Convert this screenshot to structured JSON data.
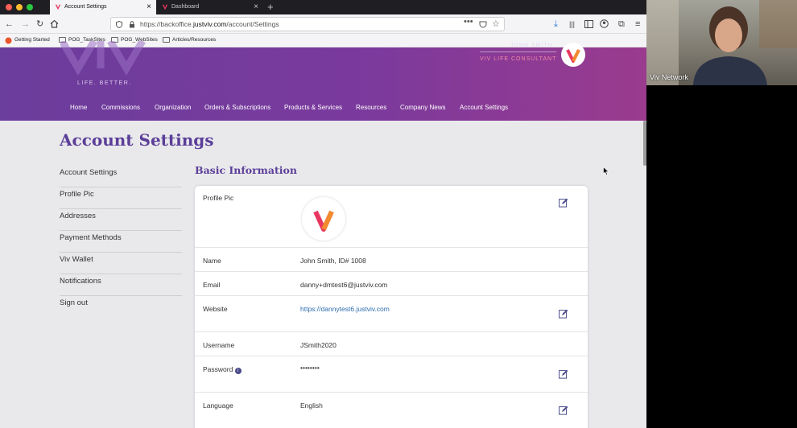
{
  "browser": {
    "tabs": [
      {
        "label": "Account Settings",
        "active": true
      },
      {
        "label": "Dashboard",
        "active": false
      }
    ],
    "url_prefix": "https://backoffice.",
    "url_domain": "justviv.com",
    "url_path": "/account/Settings",
    "bookmarks": [
      "Getting Started",
      "POG_TaskSites",
      "POG_WebSites",
      "Articles/Resources"
    ]
  },
  "site": {
    "tagline": "LIFE. BETTER.",
    "user_name": "JOHN SMITH",
    "role": "VIV LIFE CONSULTANT",
    "menu": [
      "Home",
      "Commissions",
      "Organization",
      "Orders & Subscriptions",
      "Products & Services",
      "Resources",
      "Company News",
      "Account Settings"
    ]
  },
  "page": {
    "title": "Account Settings",
    "side_nav": [
      "Account Settings",
      "Profile Pic",
      "Addresses",
      "Payment Methods",
      "Viv Wallet",
      "Notifications",
      "Sign out"
    ],
    "section_title": "Basic Information",
    "fields": {
      "profile_pic_label": "Profile Pic",
      "name_label": "Name",
      "name_value": "John Smith, ID# 1008",
      "email_label": "Email",
      "email_value": "danny+dmtest6@justviv.com",
      "website_label": "Website",
      "website_value": "https://dannytest6.justviv.com",
      "username_label": "Username",
      "username_value": "JSmith2020",
      "password_label": "Password",
      "password_value": "••••••••",
      "language_label": "Language",
      "language_value": "English"
    }
  },
  "webcam": {
    "name": "Viv Network"
  },
  "colors": {
    "brand_purple": "#5b3e98",
    "logo_pink": "#e8375f",
    "logo_orange": "#f28a2e",
    "link_blue": "#2f6db0"
  }
}
